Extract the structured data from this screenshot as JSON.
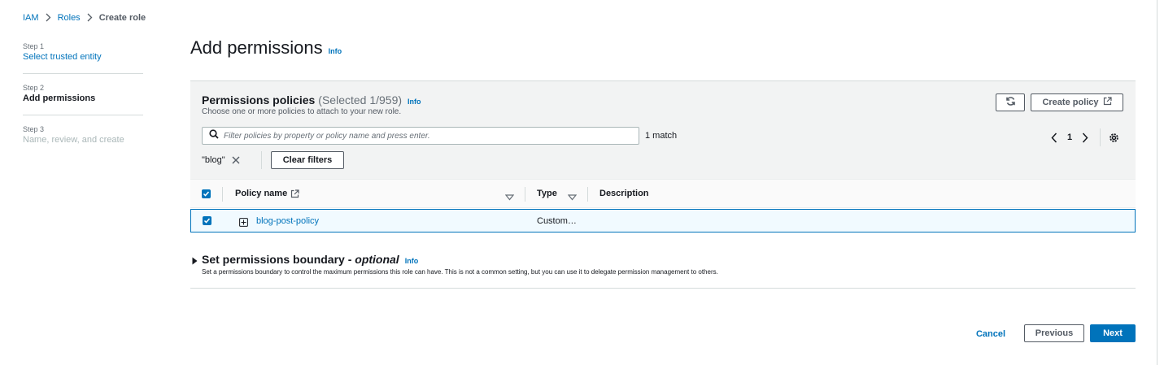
{
  "breadcrumb": {
    "items": [
      "IAM",
      "Roles",
      "Create role"
    ]
  },
  "steps": [
    {
      "number": "Step 1",
      "label": "Select trusted entity"
    },
    {
      "number": "Step 2",
      "label": "Add permissions"
    },
    {
      "number": "Step 3",
      "label": "Name, review, and create"
    }
  ],
  "page": {
    "title": "Add permissions",
    "info": "Info"
  },
  "policies": {
    "title": "Permissions policies",
    "count": "(Selected 1/959)",
    "info": "Info",
    "description": "Choose one or more policies to attach to your new role.",
    "create_label": "Create policy",
    "search_placeholder": "Filter policies by property or policy name and press enter.",
    "match_count": "1 match",
    "page_number": "1",
    "filter_token": "\"blog\"",
    "clear_filters_label": "Clear filters",
    "columns": [
      "Policy name",
      "Type",
      "Description"
    ],
    "rows": [
      {
        "name": "blog-post-policy",
        "type": "Custom…",
        "description": ""
      }
    ]
  },
  "boundary": {
    "title_prefix": "Set permissions boundary - ",
    "title_optional": "optional",
    "info": "Info",
    "description": "Set a permissions boundary to control the maximum permissions this role can have. This is not a common setting, but you can use it to delegate permission management to others."
  },
  "actions": {
    "cancel": "Cancel",
    "previous": "Previous",
    "next": "Next"
  },
  "colors": {
    "link": "#0073bb",
    "primary": "#0073bb",
    "header_bg": "#f2f3f3",
    "selected_row_bg": "#f1faff"
  },
  "icons": [
    "chevron-right-icon",
    "refresh-icon",
    "external-link-icon",
    "search-icon",
    "chevron-left-icon",
    "settings-gear-icon",
    "close-icon",
    "checkbox-checked-icon",
    "sort-down-icon",
    "expand-plus-icon",
    "caret-right-icon"
  ]
}
